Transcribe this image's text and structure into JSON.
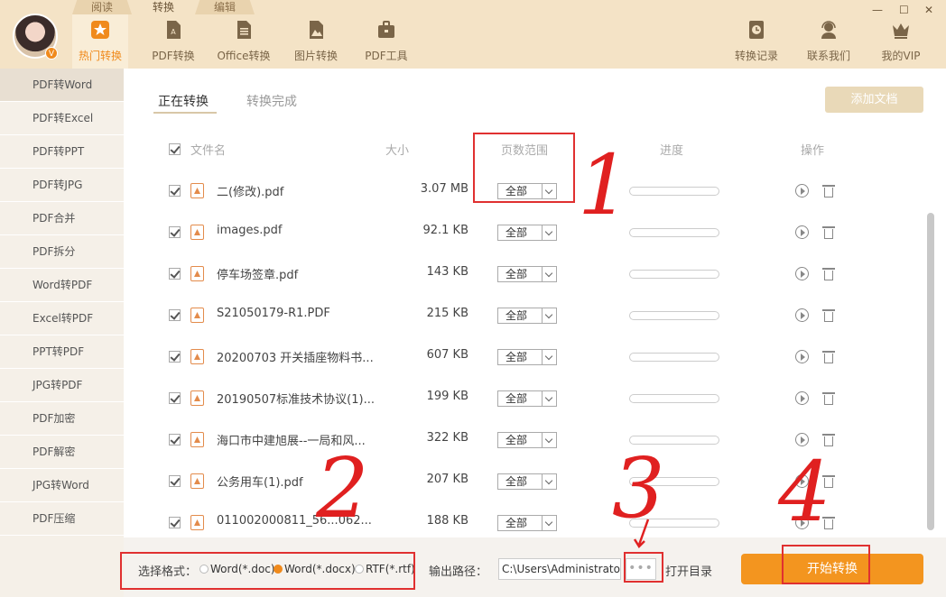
{
  "mode_tabs": [
    "阅读",
    "转换",
    "编辑"
  ],
  "avatar_badge": "V",
  "nav": {
    "hot": "热门转换",
    "pdf": "PDF转换",
    "office": "Office转换",
    "image": "图片转换",
    "tools": "PDF工具",
    "history": "转换记录",
    "contact": "联系我们",
    "vip": "我的VIP"
  },
  "window": {
    "min": "—",
    "max": "☐",
    "close": "✕"
  },
  "sidebar": {
    "items": [
      "PDF转Word",
      "PDF转Excel",
      "PDF转PPT",
      "PDF转JPG",
      "PDF合并",
      "PDF拆分",
      "Word转PDF",
      "Excel转PDF",
      "PPT转PDF",
      "JPG转PDF",
      "PDF加密",
      "PDF解密",
      "JPG转Word",
      "PDF压缩"
    ]
  },
  "tabs": {
    "converting": "正在转换",
    "done": "转换完成"
  },
  "add_doc": "添加文档",
  "table": {
    "headers": {
      "name": "文件名",
      "size": "大小",
      "range": "页数范围",
      "progress": "进度",
      "action": "操作"
    },
    "rows": [
      {
        "name": "二(修改).pdf",
        "size": "3.07 MB",
        "range": "全部",
        "progress": 0
      },
      {
        "name": "images.pdf",
        "size": "92.1 KB",
        "range": "全部",
        "progress": 0
      },
      {
        "name": "停车场签章.pdf",
        "size": "143 KB",
        "range": "全部",
        "progress": 0
      },
      {
        "name": "S21050179-R1.PDF",
        "size": "215 KB",
        "range": "全部",
        "progress": 0
      },
      {
        "name": "20200703 开关插座物料书...",
        "size": "607 KB",
        "range": "全部",
        "progress": 0
      },
      {
        "name": "20190507标准技术协议(1)...",
        "size": "199 KB",
        "range": "全部",
        "progress": 0
      },
      {
        "name": "海口市中建旭展--一局和风...",
        "size": "322 KB",
        "range": "全部",
        "progress": 0
      },
      {
        "name": "公务用车(1).pdf",
        "size": "207 KB",
        "range": "全部",
        "progress": 0
      },
      {
        "name": "011002000811_56...062...",
        "size": "188 KB",
        "range": "全部",
        "progress": 0
      }
    ]
  },
  "bottom": {
    "format_label": "选择格式：",
    "formats": [
      "Word(*.doc)",
      "Word(*.docx)",
      "RTF(*.rtf)"
    ],
    "selected_format": "Word(*.docx)",
    "output_label": "输出路径：",
    "output_path": "C:\\Users\\Administrator",
    "browse": "•••",
    "open_dir": "打开目录",
    "start": "开始转换"
  },
  "annotations": [
    "1",
    "2",
    "3",
    "4"
  ],
  "colors": {
    "accent": "#f08a1c",
    "start_button": "#f3951f",
    "topbar": "#f4e3c6",
    "annotation": "#e03030"
  }
}
